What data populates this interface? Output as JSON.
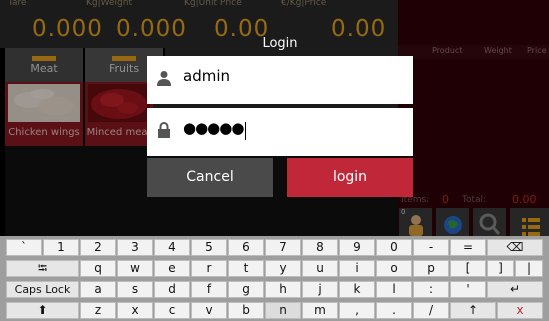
{
  "scale": {
    "tare_label": "Tare",
    "tare_value": "0.000",
    "weight_label": "Kg|Weight",
    "weight_value": "0.000",
    "unit_price_label": "Kg|Unit Price",
    "unit_price_value": "0.00",
    "price_label": "€/Kg|Price",
    "price_value": "0.00"
  },
  "categories": [
    {
      "label": "Meat"
    },
    {
      "label": "Fruits"
    }
  ],
  "products": [
    {
      "label": "Chicken wings"
    },
    {
      "label": "Minced meat"
    }
  ],
  "receipt": {
    "columns": [
      "Product",
      "Weight",
      "Price"
    ],
    "items_label": "Items:",
    "items_value": "0",
    "total_label": "Total:",
    "total_value": "0.00",
    "badge": "0"
  },
  "login_dialog": {
    "title": "Login",
    "username": "admin",
    "password_mask": "●●●●●",
    "cancel_label": "Cancel",
    "login_label": "login"
  },
  "keyboard": {
    "row1": [
      "`",
      "1",
      "2",
      "3",
      "4",
      "5",
      "6",
      "7",
      "8",
      "9",
      "0",
      "-",
      "="
    ],
    "backspace": "⌫",
    "tab": "⭾",
    "row2": [
      "q",
      "w",
      "e",
      "r",
      "t",
      "y",
      "u",
      "i",
      "o",
      "p",
      "[",
      "]",
      "|"
    ],
    "caps": "Caps Lock",
    "row3": [
      "a",
      "s",
      "d",
      "f",
      "g",
      "h",
      "j",
      "k",
      "l",
      ":",
      "'"
    ],
    "enter": "↵",
    "shift": "⬆",
    "row4": [
      "z",
      "x",
      "c",
      "v",
      "b",
      "n",
      "m",
      ",",
      ".",
      "/"
    ],
    "up": "↑",
    "close": "x"
  },
  "colors": {
    "accent": "#e8a21a",
    "dark_red": "#8c1a22",
    "login_red": "#c0283a"
  }
}
